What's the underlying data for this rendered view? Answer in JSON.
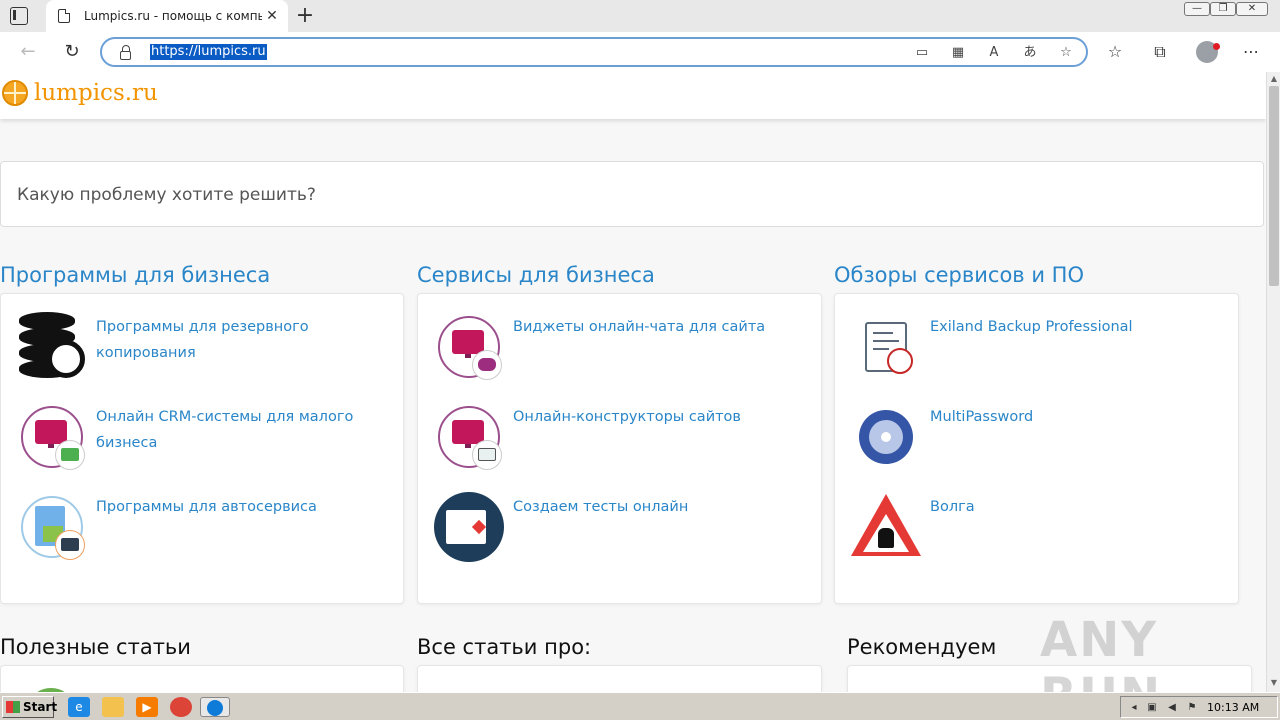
{
  "browser": {
    "tab_title": "Lumpics.ru - помощь с компью",
    "tab_close": "✕",
    "new_tab": "+",
    "url": "https://lumpics.ru",
    "win_minimize": "—",
    "win_restore": "❐",
    "win_close": "✕"
  },
  "site": {
    "logo": "lumpics.ru",
    "search_placeholder": "Какую проблему хотите решить?"
  },
  "sections": [
    {
      "title": "Программы для бизнеса",
      "items": [
        {
          "label": "Программы для резервного копирования",
          "icon": "database-backup-icon"
        },
        {
          "label": "Онлайн CRM-системы для малого бизнеса",
          "icon": "crm-monitor-icon"
        },
        {
          "label": "Программы для автосервиса",
          "icon": "autoservice-icon"
        }
      ]
    },
    {
      "title": "Сервисы для бизнеса",
      "items": [
        {
          "label": "Виджеты онлайн-чата для сайта",
          "icon": "chat-widget-icon"
        },
        {
          "label": "Онлайн-конструкторы сайтов",
          "icon": "site-builder-icon"
        },
        {
          "label": "Создаем тесты онлайн",
          "icon": "online-tests-icon"
        }
      ]
    },
    {
      "title": "Обзоры сервисов и ПО",
      "items": [
        {
          "label": "Exiland Backup Professional",
          "icon": "backup-doc-icon"
        },
        {
          "label": "MultiPassword",
          "icon": "disc-icon"
        },
        {
          "label": "Волга",
          "icon": "roadwork-sign-icon"
        }
      ]
    }
  ],
  "bottom_sections": {
    "useful": "Полезные статьи",
    "all_articles": "Все статьи про:",
    "recommend": "Рекомендуем"
  },
  "watermark": "ANY RUN",
  "taskbar": {
    "start": "Start",
    "time": "10:13 AM"
  }
}
